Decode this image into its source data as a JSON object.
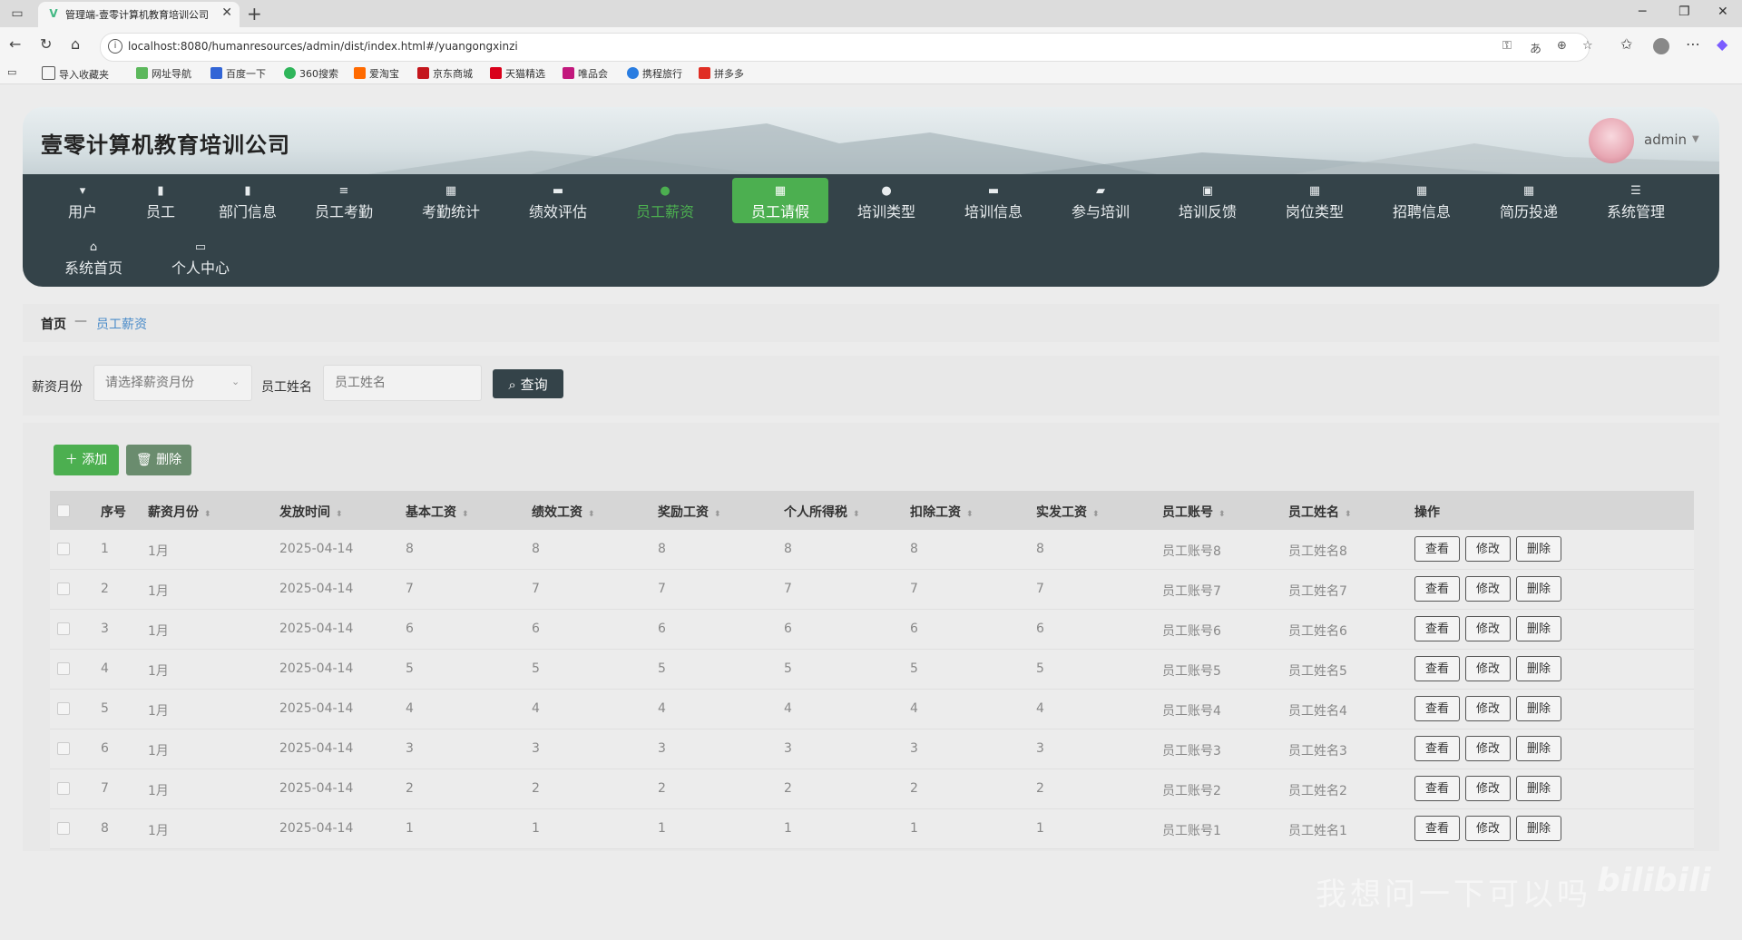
{
  "browser": {
    "tab_title": "管理端-壹零计算机教育培训公司",
    "url": "localhost:8080/humanresources/admin/dist/index.html#/yuangongxinzi",
    "bookmarks": [
      "导入收藏夹",
      "网址导航",
      "百度一下",
      "360搜索",
      "爱淘宝",
      "京东商城",
      "天猫精选",
      "唯品会",
      "携程旅行",
      "拼多多"
    ]
  },
  "header": {
    "site_title": "壹零计算机教育培训公司",
    "user": "admin"
  },
  "nav": {
    "items": [
      {
        "label": "用户",
        "icon": "user-icon"
      },
      {
        "label": "员工",
        "icon": "bar-chart-icon"
      },
      {
        "label": "部门信息",
        "icon": "building-icon"
      },
      {
        "label": "员工考勤",
        "icon": "list-icon"
      },
      {
        "label": "考勤统计",
        "icon": "grid-icon"
      },
      {
        "label": "绩效评估",
        "icon": "monitor-icon"
      },
      {
        "label": "员工薪资",
        "icon": "person-icon"
      },
      {
        "label": "员工请假",
        "icon": "grid-icon"
      },
      {
        "label": "培训类型",
        "icon": "pin-icon"
      },
      {
        "label": "培训信息",
        "icon": "monitor-icon"
      },
      {
        "label": "参与培训",
        "icon": "ticket-icon"
      },
      {
        "label": "培训反馈",
        "icon": "clipboard-icon"
      },
      {
        "label": "岗位类型",
        "icon": "grid-icon"
      },
      {
        "label": "招聘信息",
        "icon": "grid-icon"
      },
      {
        "label": "简历投递",
        "icon": "grid-icon"
      },
      {
        "label": "系统管理",
        "icon": "sliders-icon"
      },
      {
        "label": "系统首页",
        "icon": "home-icon"
      },
      {
        "label": "个人中心",
        "icon": "card-icon"
      }
    ]
  },
  "breadcrumb": {
    "home": "首页",
    "separator": "—",
    "current": "员工薪资"
  },
  "search": {
    "month_label": "薪资月份",
    "month_placeholder": "请选择薪资月份",
    "name_label": "员工姓名",
    "name_placeholder": "员工姓名",
    "query_button": "查询"
  },
  "toolbar": {
    "add": "添加",
    "delete": "删除"
  },
  "table": {
    "headers": [
      "序号",
      "薪资月份",
      "发放时间",
      "基本工资",
      "绩效工资",
      "奖励工资",
      "个人所得税",
      "扣除工资",
      "实发工资",
      "员工账号",
      "员工姓名",
      "操作"
    ],
    "actions": {
      "view": "查看",
      "edit": "修改",
      "delete": "删除"
    },
    "rows": [
      [
        "1",
        "1月",
        "2025-04-14",
        "8",
        "8",
        "8",
        "8",
        "8",
        "8",
        "员工账号8",
        "员工姓名8"
      ],
      [
        "2",
        "1月",
        "2025-04-14",
        "7",
        "7",
        "7",
        "7",
        "7",
        "7",
        "员工账号7",
        "员工姓名7"
      ],
      [
        "3",
        "1月",
        "2025-04-14",
        "6",
        "6",
        "6",
        "6",
        "6",
        "6",
        "员工账号6",
        "员工姓名6"
      ],
      [
        "4",
        "1月",
        "2025-04-14",
        "5",
        "5",
        "5",
        "5",
        "5",
        "5",
        "员工账号5",
        "员工姓名5"
      ],
      [
        "5",
        "1月",
        "2025-04-14",
        "4",
        "4",
        "4",
        "4",
        "4",
        "4",
        "员工账号4",
        "员工姓名4"
      ],
      [
        "6",
        "1月",
        "2025-04-14",
        "3",
        "3",
        "3",
        "3",
        "3",
        "3",
        "员工账号3",
        "员工姓名3"
      ],
      [
        "7",
        "1月",
        "2025-04-14",
        "2",
        "2",
        "2",
        "2",
        "2",
        "2",
        "员工账号2",
        "员工姓名2"
      ],
      [
        "8",
        "1月",
        "2025-04-14",
        "1",
        "1",
        "1",
        "1",
        "1",
        "1",
        "员工账号1",
        "员工姓名1"
      ]
    ]
  },
  "overlay": {
    "subtitle": "我想问一下可以吗",
    "logo": "bilibili"
  },
  "colors": {
    "nav_bg": "#344349",
    "accent": "#4caf50",
    "link": "#4a8bc9"
  }
}
